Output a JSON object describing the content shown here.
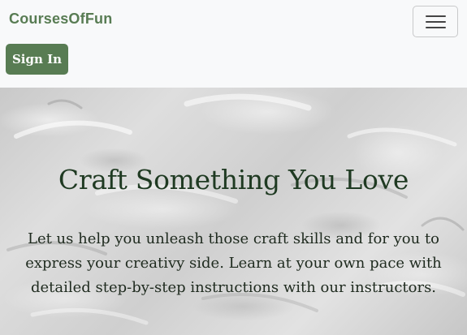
{
  "navbar": {
    "brand": "CoursesOfFun",
    "toggler_icon": "hamburger-menu-icon",
    "signin_label": "Sign In"
  },
  "hero": {
    "title": "Craft Something You Love",
    "text": "Let us help you unleash those craft skills and for you to express your creativy side. Learn at your own pace with detailed step-by-step instructions with our instructors."
  },
  "colors": {
    "brand": "#587c53",
    "button_bg": "#587c53",
    "navbar_bg": "#f8f9fa",
    "hero_title": "#1f3a22"
  }
}
